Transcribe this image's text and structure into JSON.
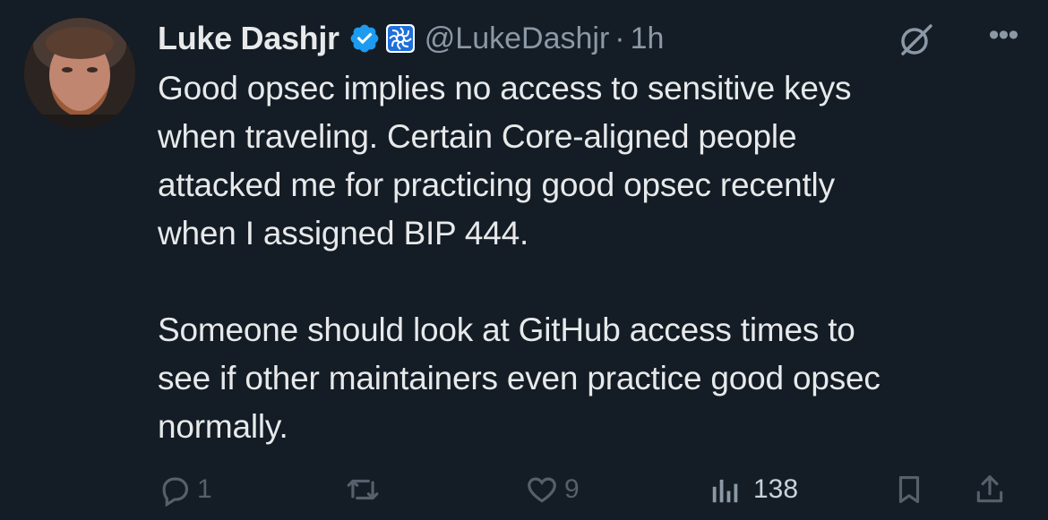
{
  "author": {
    "display_name": "Luke Dashjr",
    "handle": "@LukeDashjr",
    "separator": "·",
    "time_ago": "1h",
    "verified_icon": "verified-badge-icon",
    "affiliate_icon": "affiliate-badge-icon"
  },
  "tweet": {
    "text": "Good opsec implies no access to sensitive keys\nwhen traveling. Certain Core-aligned people\nattacked me for practicing good opsec recently\nwhen I assigned BIP 444.\n\nSomeone should look at GitHub access times to\nsee if other maintainers even practice good opsec\nnormally."
  },
  "actions": {
    "reply_count": "1",
    "repost_count": "",
    "like_count": "9",
    "view_count": "138"
  },
  "colors": {
    "background": "#141c25",
    "text": "#e7e9ea",
    "muted": "#8b98a5",
    "verified": "#1d9bf0"
  }
}
